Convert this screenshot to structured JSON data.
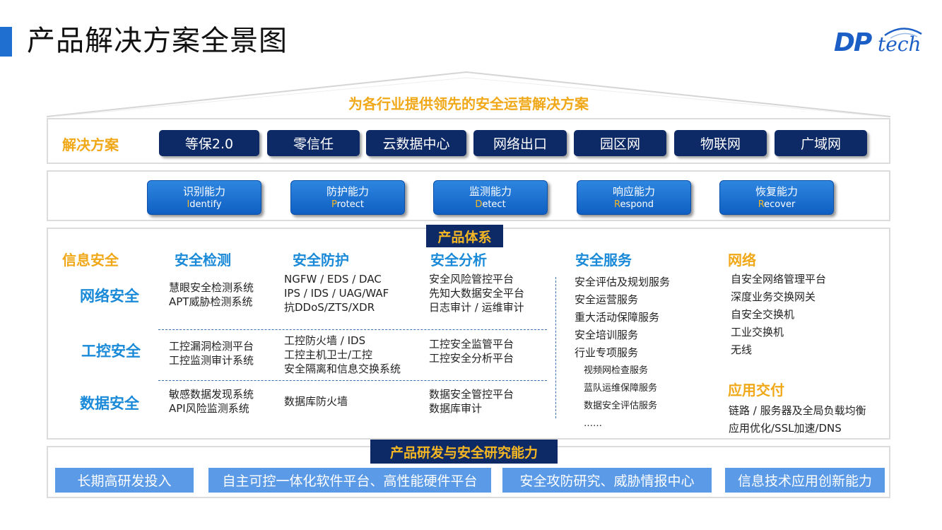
{
  "page_title": "产品解决方案全景图",
  "logo": {
    "dp": "DP",
    "tech": "tech"
  },
  "slogan": "为各行业提供领先的安全运营解决方案",
  "solutions": {
    "label": "解决方案",
    "items": [
      "等保2.0",
      "零信任",
      "云数据中心",
      "网络出口",
      "园区网",
      "物联网",
      "广域网"
    ]
  },
  "capabilities": [
    {
      "zh": "识别能力",
      "initial": "I",
      "rest": "dentify"
    },
    {
      "zh": "防护能力",
      "initial": "P",
      "rest": "rotect"
    },
    {
      "zh": "监测能力",
      "initial": "D",
      "rest": "etect"
    },
    {
      "zh": "响应能力",
      "initial": "R",
      "rest": "espond"
    },
    {
      "zh": "恢复能力",
      "initial": "R",
      "rest": "ecover"
    }
  ],
  "product_system": {
    "tag": "产品体系",
    "info_security": "信息安全",
    "col_headers": {
      "detect": "安全检测",
      "protect": "安全防护",
      "analysis": "安全分析"
    },
    "rows": [
      {
        "title": "网络安全",
        "detect": [
          "慧眼安全检测系统",
          "APT威胁检测系统"
        ],
        "protect": [
          "NGFW / EDS / DAC",
          "IPS / IDS / UAG/WAF",
          "抗DDoS/ZTS/XDR"
        ],
        "analysis": [
          "安全风险管控平台",
          "先知大数据安全平台",
          "日志审计 / 运维审计"
        ]
      },
      {
        "title": "工控安全",
        "detect": [
          "工控漏洞检测平台",
          "工控监测审计系统"
        ],
        "protect": [
          "工控防火墙 / IDS",
          "工控主机卫士/工控",
          "安全隔离和信息交换系统"
        ],
        "analysis": [
          "工控安全监管平台",
          "工控安全分析平台"
        ]
      },
      {
        "title": "数据安全",
        "detect": [
          "敏感数据发现系统",
          "API风险监测系统"
        ],
        "protect": [
          "数据库防火墙"
        ],
        "analysis": [
          "数据安全管控平台",
          "数据库审计"
        ]
      }
    ],
    "services": {
      "title": "安全服务",
      "items": [
        "安全评估及规划服务",
        "安全运营服务",
        "重大活动保障服务",
        "安全培训服务",
        "行业专项服务"
      ],
      "sub_items": [
        "视频网检查服务",
        "蓝队运维保障服务",
        "数据安全评估服务",
        "……"
      ]
    },
    "network": {
      "title": "网络",
      "items": [
        "自安全网络管理平台",
        "深度业务交换网关",
        "自安全交换机",
        "工业交换机",
        "无线"
      ]
    },
    "app_delivery": {
      "title": "应用交付",
      "items": [
        "链路 / 服务器及全局负载均衡",
        "应用优化/SSL加速/DNS"
      ]
    }
  },
  "rd": {
    "tag": "产品研发与安全研究能力",
    "items": [
      "长期高研发投入",
      "自主可控一体化软件平台、高性能硬件平台",
      "安全攻防研究、威胁情报中心",
      "信息技术应用创新能力"
    ]
  }
}
